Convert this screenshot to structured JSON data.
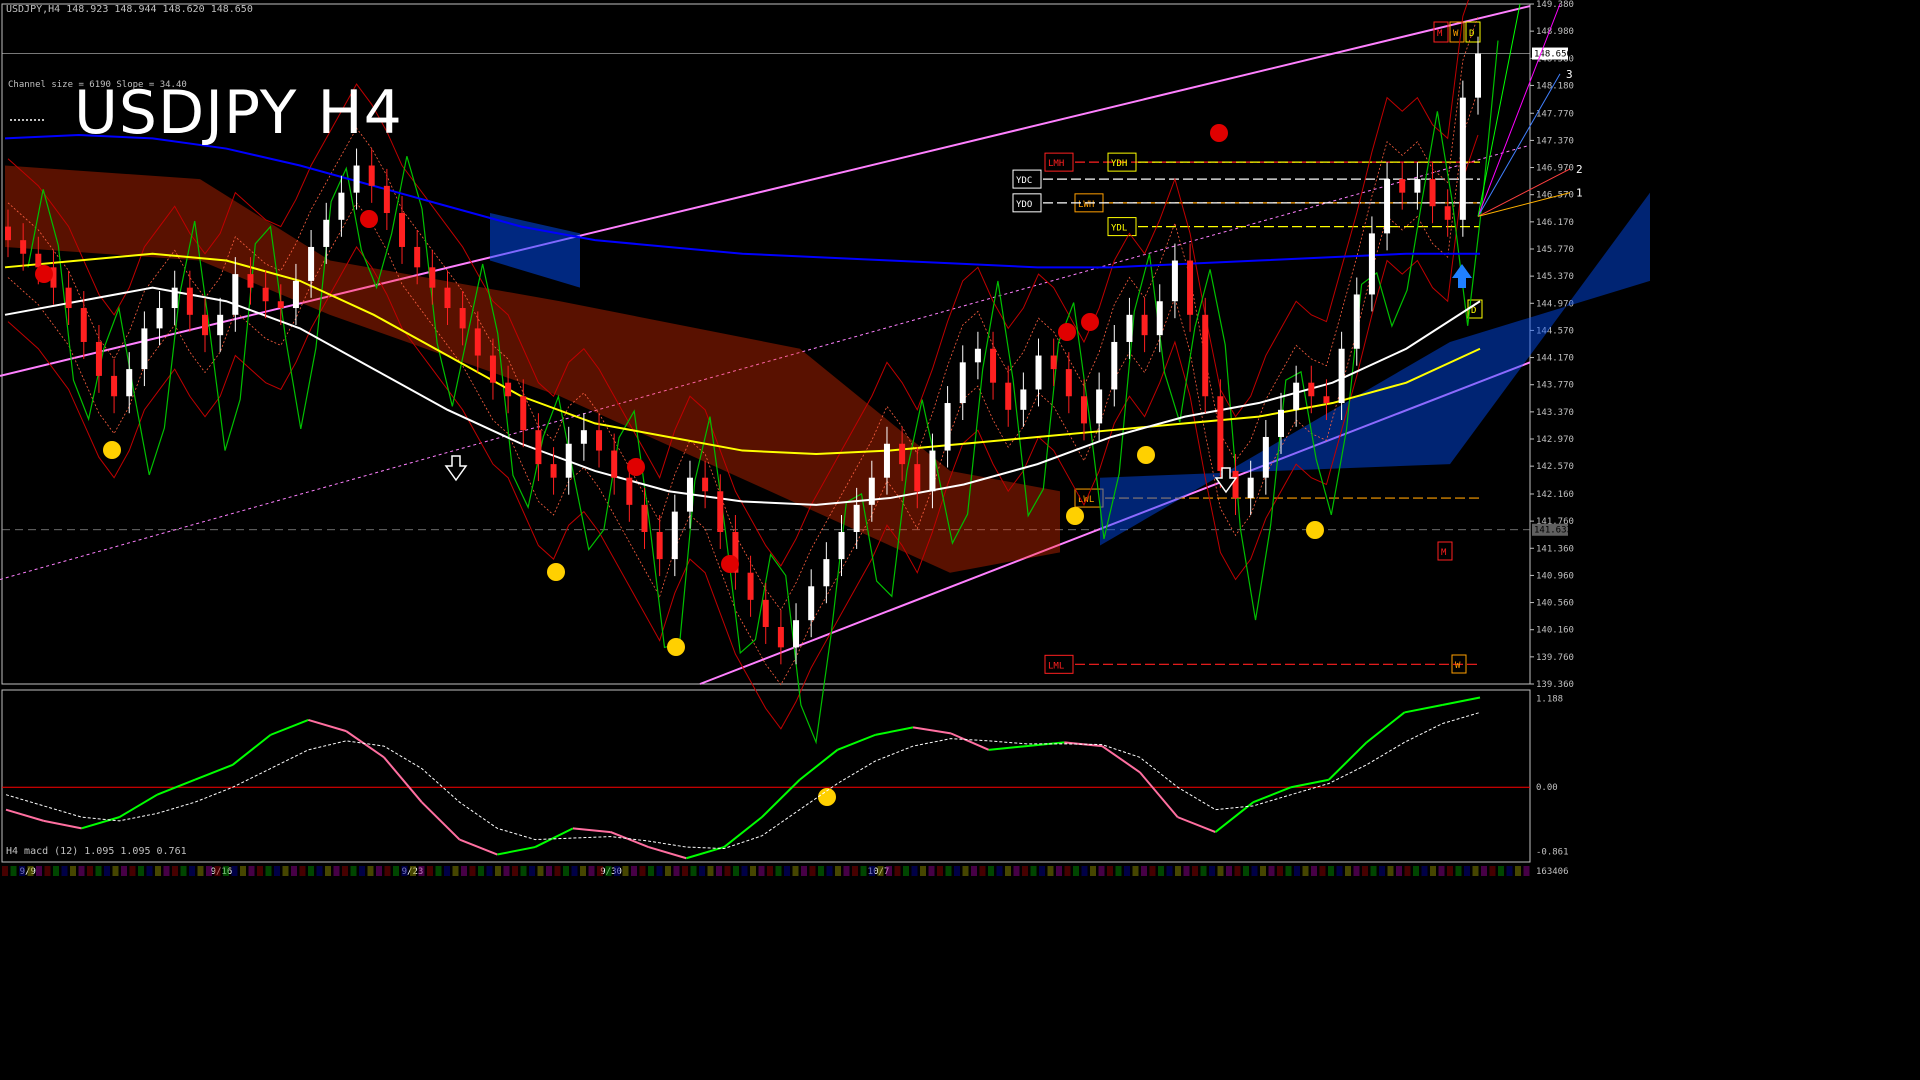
{
  "header": {
    "symbol_bar": "USDJPY,H4  148.923 148.944 148.620 148.650",
    "channel_info": "Channel size = 6190 Slope = 34.40",
    "big_title": "USDJPY H4",
    "macd_info": "H4  macd (12) 1.095 1.095 0.761"
  },
  "colors": {
    "background": "#000000",
    "bull_candle": "#ffffff",
    "bear_candle": "#ff2020",
    "channel": "#ff80ff",
    "ma_white": "#ffffff",
    "ma_yellow": "#ffff00",
    "ma_blue": "#0000ff",
    "chikou_green": "#00c000",
    "bollinger_red": "#c00000",
    "cloud_red": "#ff3000",
    "cloud_blue": "#0050ff",
    "macd_line_up": "#00ff00",
    "macd_line_down": "#ff6fa0",
    "macd_zero": "#ff0000",
    "axis_text": "#c0c0c0"
  },
  "chart_data": [
    {
      "type": "candlestick",
      "title": "USDJPY H4",
      "ylim": [
        139.36,
        149.38
      ],
      "price_ticks": [
        "149.380",
        "148.980",
        "148.580",
        "148.180",
        "147.770",
        "147.370",
        "146.970",
        "146.570",
        "146.170",
        "145.770",
        "145.370",
        "144.970",
        "144.570",
        "144.170",
        "143.770",
        "143.370",
        "142.970",
        "142.570",
        "142.160",
        "141.760",
        "141.360",
        "140.960",
        "140.560",
        "140.160",
        "139.760",
        "139.360"
      ],
      "current_price_label": "148.650",
      "level_label": "141.633",
      "x_labels": [
        "9/9",
        "9/16",
        "9/23",
        "9/30",
        "10/7"
      ],
      "close_series": [
        145.9,
        145.7,
        145.5,
        145.2,
        144.9,
        144.4,
        143.9,
        143.6,
        144.0,
        144.6,
        144.9,
        145.2,
        144.8,
        144.5,
        144.8,
        145.4,
        145.2,
        145.0,
        144.9,
        145.3,
        145.8,
        146.2,
        146.6,
        147.0,
        146.7,
        146.3,
        145.8,
        145.5,
        145.2,
        144.9,
        144.6,
        144.2,
        143.8,
        143.6,
        143.1,
        142.6,
        142.4,
        142.9,
        143.1,
        142.8,
        142.4,
        142.0,
        141.6,
        141.2,
        141.9,
        142.4,
        142.2,
        141.6,
        141.0,
        140.6,
        140.2,
        139.9,
        140.3,
        140.8,
        141.2,
        141.6,
        142.0,
        142.4,
        142.9,
        142.6,
        142.2,
        142.8,
        143.5,
        144.1,
        144.3,
        143.8,
        143.4,
        143.7,
        144.2,
        144.0,
        143.6,
        143.2,
        143.7,
        144.4,
        144.8,
        144.5,
        145.0,
        145.6,
        144.8,
        143.6,
        142.5,
        142.1,
        142.4,
        143.0,
        143.4,
        143.8,
        143.6,
        143.5,
        144.3,
        145.1,
        146.0,
        146.8,
        146.6,
        146.8,
        146.4,
        146.2,
        148.0,
        148.65
      ],
      "series": [
        {
          "name": "M",
          "values": [
            147.4,
            147.45,
            147.4,
            147.25,
            147.0,
            146.7,
            146.4,
            146.1,
            145.9,
            145.8,
            145.7,
            145.65,
            145.6,
            145.55,
            145.5,
            145.5,
            145.55,
            145.6,
            145.65,
            145.7,
            145.7
          ]
        },
        {
          "name": "W",
          "values": [
            145.5,
            145.6,
            145.7,
            145.6,
            145.3,
            144.8,
            144.2,
            143.6,
            143.2,
            143.0,
            142.8,
            142.75,
            142.8,
            142.9,
            143.0,
            143.1,
            143.2,
            143.3,
            143.5,
            143.8,
            144.3
          ]
        },
        {
          "name": "D",
          "values": [
            144.8,
            145.0,
            145.2,
            145.0,
            144.6,
            144.0,
            143.4,
            142.9,
            142.5,
            142.2,
            142.05,
            142.0,
            142.1,
            142.3,
            142.6,
            143.0,
            143.3,
            143.5,
            143.8,
            144.3,
            145.0
          ]
        }
      ],
      "channel": {
        "lower": {
          "start": 139.0,
          "end": 144.1
        },
        "upper": {
          "start": 143.9,
          "end": 149.35
        },
        "mid": {
          "start": 140.9,
          "end": 147.3
        }
      },
      "levels": [
        {
          "label": "LMH",
          "price": 147.05,
          "color": "#ff2020"
        },
        {
          "label": "YDH",
          "price": 147.05,
          "color": "#ffff00"
        },
        {
          "label": "YDC",
          "price": 146.8,
          "color": "#ffffff"
        },
        {
          "label": "LWH",
          "price": 146.45,
          "color": "#ff9f00"
        },
        {
          "label": "YDO",
          "price": 146.45,
          "color": "#ffffff"
        },
        {
          "label": "YDL",
          "price": 146.1,
          "color": "#ffff00"
        },
        {
          "label": "LWL",
          "price": 142.1,
          "color": "#ff9f00"
        },
        {
          "label": "LML",
          "price": 139.65,
          "color": "#ff2020"
        }
      ],
      "level_tags": [
        {
          "label": "M",
          "color": "#ff2020"
        },
        {
          "label": "W",
          "color": "#ff9f00"
        },
        {
          "label": "D",
          "color": "#ffff00"
        }
      ],
      "level_tags_lower": [
        {
          "label": "D",
          "color": "#ffff00"
        },
        {
          "label": "M",
          "color": "#ff2020"
        },
        {
          "label": "W",
          "color": "#ff9f00"
        }
      ],
      "fan_labels": [
        "3",
        "2",
        "1"
      ]
    },
    {
      "type": "line",
      "title": "H4 macd (12) 1.095 1.095 0.761",
      "ylim": [
        -1.0,
        1.3
      ],
      "y_ticks": [
        "1.188",
        "0.00",
        "-0.861"
      ],
      "bottom_label": "163406",
      "series": [
        {
          "name": "macd",
          "values": [
            -0.3,
            -0.45,
            -0.55,
            -0.4,
            -0.1,
            0.1,
            0.3,
            0.7,
            0.9,
            0.75,
            0.4,
            -0.2,
            -0.7,
            -0.9,
            -0.8,
            -0.55,
            -0.6,
            -0.8,
            -0.95,
            -0.8,
            -0.4,
            0.1,
            0.5,
            0.7,
            0.8,
            0.72,
            0.5,
            0.55,
            0.6,
            0.55,
            0.2,
            -0.4,
            -0.6,
            -0.2,
            0.0,
            0.1,
            0.6,
            1.0,
            1.1,
            1.2
          ]
        },
        {
          "name": "signal",
          "values": [
            -0.1,
            -0.25,
            -0.4,
            -0.45,
            -0.35,
            -0.2,
            0.0,
            0.25,
            0.5,
            0.62,
            0.55,
            0.25,
            -0.2,
            -0.55,
            -0.7,
            -0.68,
            -0.66,
            -0.72,
            -0.8,
            -0.82,
            -0.65,
            -0.3,
            0.05,
            0.35,
            0.55,
            0.65,
            0.62,
            0.58,
            0.58,
            0.57,
            0.4,
            0.0,
            -0.3,
            -0.25,
            -0.1,
            0.05,
            0.3,
            0.6,
            0.85,
            1.0
          ]
        }
      ]
    }
  ]
}
